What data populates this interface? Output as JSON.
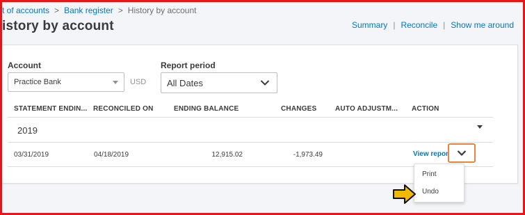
{
  "breadcrumb": {
    "items": [
      "t of accounts",
      "Bank register"
    ],
    "separator": ">",
    "current": "History by account"
  },
  "page_title": "istory by account",
  "top_links": [
    "Summary",
    "Reconcile",
    "Show me around"
  ],
  "top_links_separator": "|",
  "filters": {
    "account_label": "Account",
    "account_value": "Practice Bank",
    "currency": "USD",
    "period_label": "Report period",
    "period_value": "All Dates"
  },
  "table": {
    "headers": [
      "STATEMENT ENDIN...",
      "RECONCILED ON",
      "ENDING BALANCE",
      "CHANGES",
      "AUTO ADJUSTM...",
      "ACTION"
    ],
    "group": "2019",
    "row": {
      "statement_ending": "03/31/2019",
      "reconciled_on": "04/18/2019",
      "ending_balance": "12,915.02",
      "changes": "-1,973.49",
      "action": "View report"
    }
  },
  "action_menu": [
    "Print",
    "Undo"
  ],
  "icons": {
    "caret": "chevron-down-icon",
    "pointer": "arrow-right-icon"
  },
  "colors": {
    "frame_border": "#e8141c",
    "link": "#0077c5",
    "highlight_border": "#e8853a",
    "arrow_fill": "#f5b800"
  }
}
